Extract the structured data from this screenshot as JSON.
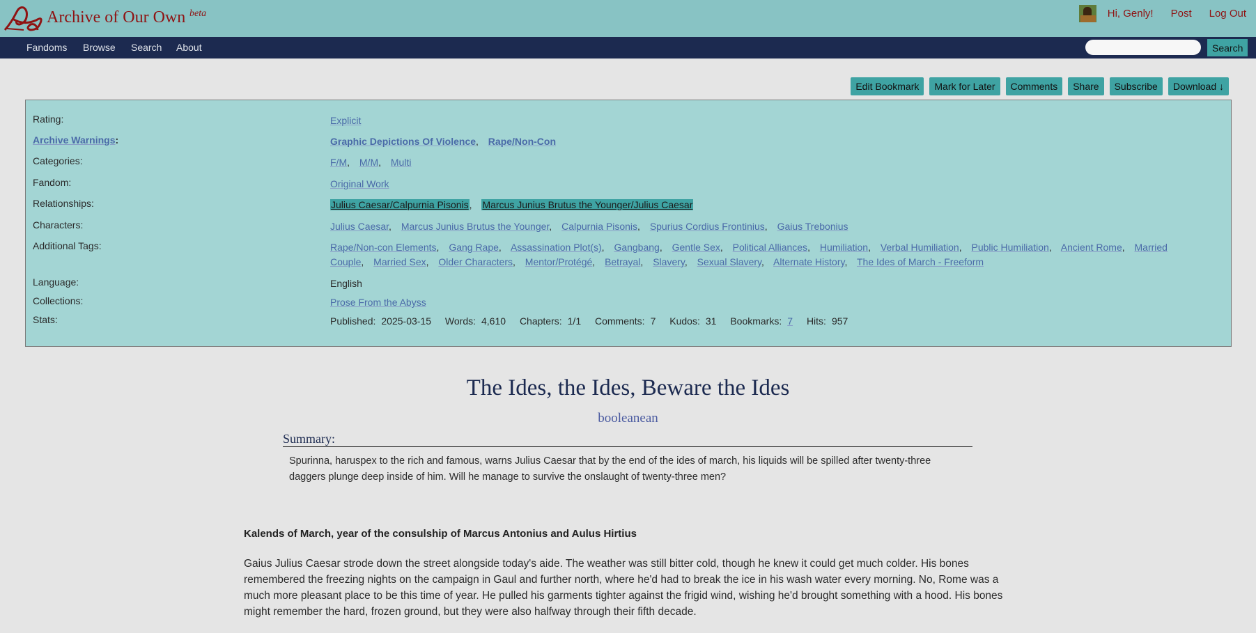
{
  "header": {
    "site_title": "Archive of Our Own",
    "beta": "beta",
    "user_greeting": "Hi, Genly!",
    "post_label": "Post",
    "logout_label": "Log Out"
  },
  "nav": {
    "items": [
      "Fandoms",
      "Browse",
      "Search",
      "About"
    ],
    "search_button": "Search",
    "search_placeholder": ""
  },
  "actions": [
    "Edit Bookmark",
    "Mark for Later",
    "Comments",
    "Share",
    "Subscribe",
    "Download ↓"
  ],
  "meta": {
    "rating_label": "Rating:",
    "rating": "Explicit",
    "warnings_label": "Archive Warnings",
    "warnings_colon": ":",
    "warnings": [
      "Graphic Depictions Of Violence",
      "Rape/Non-Con"
    ],
    "categories_label": "Categories:",
    "categories": [
      "F/M",
      "M/M",
      "Multi"
    ],
    "fandom_label": "Fandom:",
    "fandom": "Original Work",
    "relationships_label": "Relationships:",
    "relationships": [
      "Julius Caesar/Calpurnia Pisonis",
      "Marcus Junius Brutus the Younger/Julius Caesar"
    ],
    "characters_label": "Characters:",
    "characters": [
      "Julius Caesar",
      "Marcus Junius Brutus the Younger",
      "Calpurnia Pisonis",
      "Spurius Cordius Frontinius",
      "Gaius Trebonius"
    ],
    "tags_label": "Additional Tags:",
    "tags": [
      "Rape/Non-con Elements",
      "Gang Rape",
      "Assassination Plot(s)",
      "Gangbang",
      "Gentle Sex",
      "Political Alliances",
      "Humiliation",
      "Verbal Humiliation",
      "Public Humiliation",
      "Ancient Rome",
      "Married Couple",
      "Married Sex",
      "Older Characters",
      "Mentor/Protégé",
      "Betrayal",
      "Slavery",
      "Sexual Slavery",
      "Alternate History",
      "The Ides of March - Freeform"
    ],
    "language_label": "Language:",
    "language": "English",
    "collections_label": "Collections:",
    "collections": "Prose From the Abyss",
    "stats_label": "Stats:",
    "stats": {
      "published_label": "Published:",
      "published": "2025-03-15",
      "words_label": "Words:",
      "words": "4,610",
      "chapters_label": "Chapters:",
      "chapters": "1/1",
      "comments_label": "Comments:",
      "comments": "7",
      "kudos_label": "Kudos:",
      "kudos": "31",
      "bookmarks_label": "Bookmarks:",
      "bookmarks": "7",
      "hits_label": "Hits:",
      "hits": "957"
    }
  },
  "work": {
    "title": "The Ides, the Ides, Beware the Ides",
    "author": "booleanean",
    "summary_heading": "Summary:",
    "summary": "Spurinna, haruspex to the rich and famous, warns Julius Caesar that by the end of the ides of march, his liquids will be spilled after twenty-three daggers plunge deep inside of him. Will he manage to survive the onslaught of twenty-three men?",
    "chapter_heading": "Kalends of March, year of the consulship of Marcus Antonius and Aulus Hirtius",
    "body": "Gaius Julius Caesar strode down the street alongside today's aide. The weather was still bitter cold, though he knew it could get much colder. His bones remembered the freezing nights on the campaign in Gaul and further north, where he'd had to break the ice in his wash water every morning. No, Rome was a much more pleasant place to be this time of year. He pulled his garments tighter against the frigid wind, wishing he'd brought something with a hood. His bones might remember the hard, frozen ground, but they were also halfway through their fifth decade."
  }
}
